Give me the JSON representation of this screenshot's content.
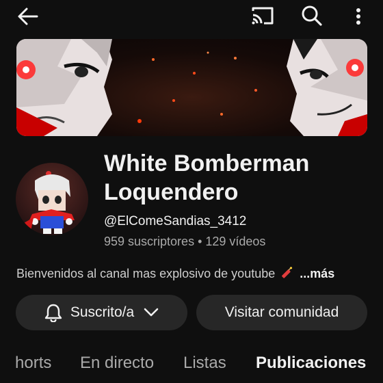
{
  "channel": {
    "name_line1": "White Bomberman",
    "name_line2": "Loquendero",
    "handle": "@ElComeSandias_3412",
    "stats": "959 suscriptores • 129 vídeos",
    "description": "Bienvenidos al canal mas explosivo de youtube",
    "more_label": "...más"
  },
  "buttons": {
    "subscribed_label": "Suscrito/a",
    "community_label": "Visitar comunidad"
  },
  "tabs": [
    {
      "label": "horts"
    },
    {
      "label": "En directo"
    },
    {
      "label": "Listas"
    },
    {
      "label": "Publicaciones"
    }
  ],
  "icons": {
    "back": "arrow-left-icon",
    "cast": "cast-icon",
    "search": "search-icon",
    "more": "more-vertical-icon",
    "bell": "bell-icon",
    "chevron": "chevron-down-icon",
    "dynamite": "dynamite-icon"
  },
  "colors": {
    "background": "#0f0f0f",
    "pill": "#272727",
    "secondary_text": "#aaaaaa"
  }
}
